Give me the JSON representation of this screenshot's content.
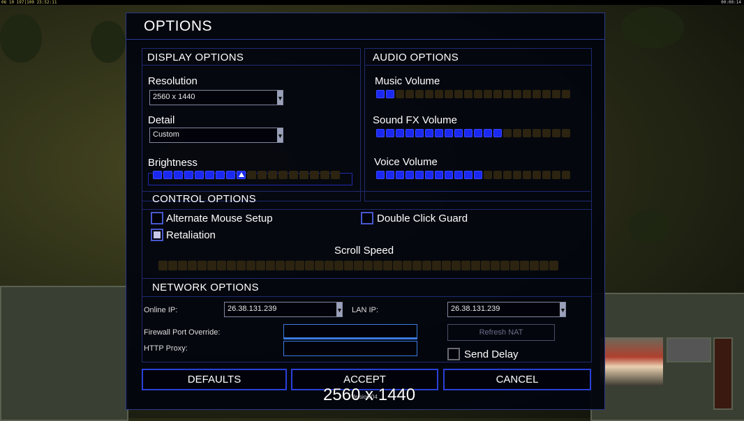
{
  "status_bar": {
    "left": "06 10 197|100 23:52:11",
    "right": "00:00:14"
  },
  "dialog": {
    "title": "OPTIONS",
    "display": {
      "heading": "DISPLAY OPTIONS",
      "resolution_label": "Resolution",
      "resolution_value": "2560 x 1440",
      "detail_label": "Detail",
      "detail_value": "Custom",
      "brightness_label": "Brightness",
      "brightness_level": 0.5
    },
    "audio": {
      "heading": "AUDIO OPTIONS",
      "music_label": "Music Volume",
      "music_level": 0.1,
      "sfx_label": "Sound FX Volume",
      "sfx_level": 0.65,
      "voice_label": "Voice Volume",
      "voice_level": 0.55
    },
    "control": {
      "heading": "CONTROL OPTIONS",
      "alt_mouse_label": "Alternate Mouse Setup",
      "alt_mouse_checked": false,
      "double_click_label": "Double Click Guard",
      "double_click_checked": false,
      "retaliation_label": "Retaliation",
      "retaliation_checked": true,
      "scroll_speed_label": "Scroll Speed",
      "scroll_speed_level": 0
    },
    "network": {
      "heading": "NETWORK OPTIONS",
      "online_ip_label": "Online IP:",
      "online_ip_value": "26.38.131.239",
      "lan_ip_label": "LAN IP:",
      "lan_ip_value": "26.38.131.239",
      "firewall_label": "Firewall Port Override:",
      "firewall_value": "",
      "proxy_label": "HTTP Proxy:",
      "proxy_value": "",
      "refresh_nat_label": "Refresh NAT",
      "send_delay_label": "Send Delay",
      "send_delay_checked": false
    },
    "buttons": {
      "defaults": "DEFAULTS",
      "accept": "ACCEPT",
      "cancel": "CANCEL"
    },
    "version_text": "Version 04",
    "resolution_overlay": "2560 x 1440"
  },
  "colors": {
    "accent": "#1a28f0",
    "border": "#2a40d8",
    "panel_bg": "#02040e"
  }
}
